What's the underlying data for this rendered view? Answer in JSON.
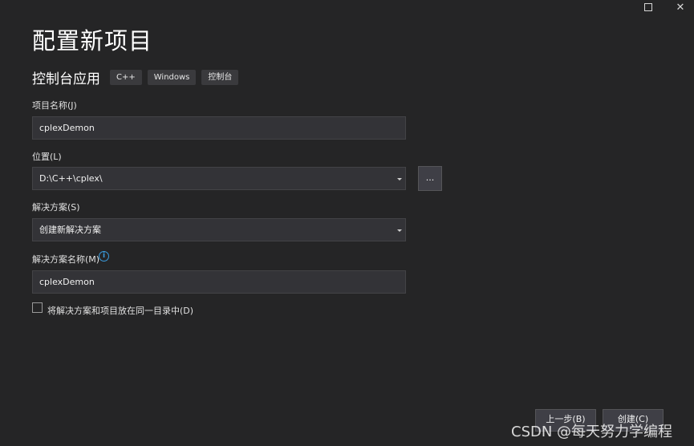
{
  "window": {
    "maximize_icon": "maximize-icon",
    "close_glyph": "✕"
  },
  "title": "配置新项目",
  "template": {
    "name": "控制台应用",
    "tags": [
      "C++",
      "Windows",
      "控制台"
    ]
  },
  "form": {
    "project_name_label": "项目名称(J)",
    "project_name_value": "cplexDemon",
    "location_label": "位置(L)",
    "location_value": "D:\\C++\\cplex\\",
    "browse_label": "...",
    "solution_label": "解决方案(S)",
    "solution_value": "创建新解决方案",
    "solution_name_label": "解决方案名称(M)",
    "solution_name_value": "cplexDemon",
    "info_icon": "info-icon",
    "info_glyph": "i",
    "same_dir_label": "将解决方案和项目放在同一目录中(D)",
    "same_dir_checked": false
  },
  "footer": {
    "back_label": "上一步(B)",
    "create_label": "创建(C)"
  },
  "watermark": "CSDN @每天努力学编程",
  "colors": {
    "background": "#252526",
    "field": "#333337",
    "tag": "#3a3a3d",
    "info_accent": "#3a9bdc"
  }
}
